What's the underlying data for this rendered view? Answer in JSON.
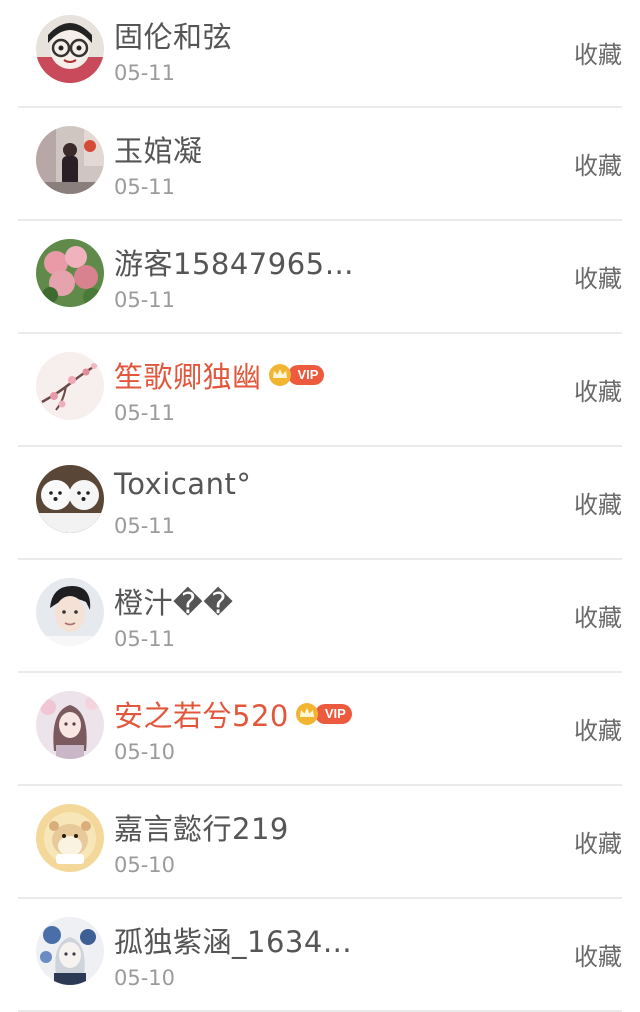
{
  "rows": [
    {
      "name": "固伦和弦",
      "date": "05-11",
      "action": "收藏",
      "vip": false,
      "avatar": "avatar-cartoon-glasses"
    },
    {
      "name": "玉婠凝",
      "date": "05-11",
      "action": "收藏",
      "vip": false,
      "avatar": "avatar-street-photo"
    },
    {
      "name": "游客15847965…",
      "date": "05-11",
      "action": "收藏",
      "vip": false,
      "avatar": "avatar-flowers"
    },
    {
      "name": "笙歌卿独幽",
      "date": "05-11",
      "action": "收藏",
      "vip": true,
      "vip_label": "VIP",
      "avatar": "avatar-plum-blossom"
    },
    {
      "name": "Toxicant°",
      "date": "05-11",
      "action": "收藏",
      "vip": false,
      "avatar": "avatar-white-dogs"
    },
    {
      "name": "橙汁��",
      "date": "05-11",
      "action": "收藏",
      "vip": false,
      "avatar": "avatar-boy-portrait"
    },
    {
      "name": "安之若兮520",
      "date": "05-10",
      "action": "收藏",
      "vip": true,
      "vip_label": "VIP",
      "avatar": "avatar-anime-girl"
    },
    {
      "name": "嘉言懿行219",
      "date": "05-10",
      "action": "收藏",
      "vip": false,
      "avatar": "avatar-hamster"
    },
    {
      "name": "孤独紫涵_1634…",
      "date": "05-10",
      "action": "收藏",
      "vip": false,
      "avatar": "avatar-anime-flowers"
    }
  ],
  "colors": {
    "name": "#555555",
    "vip_name": "#e2573c",
    "date": "#9b9b9b",
    "action": "#6a6a6a",
    "divider": "#ebebeb",
    "vip_badge": "#ec5b3e",
    "crown": "#f2b531"
  }
}
